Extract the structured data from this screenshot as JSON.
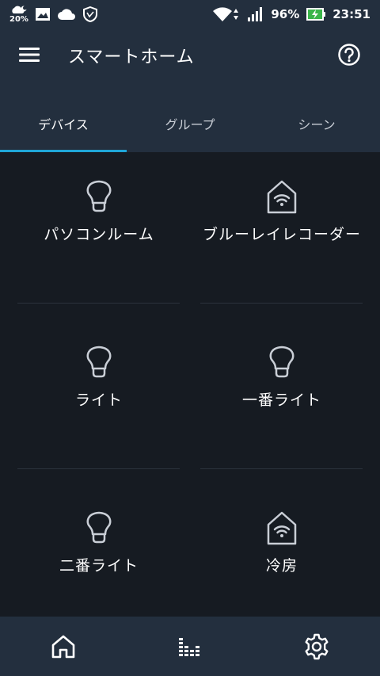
{
  "status_bar": {
    "weather_pct": "20%",
    "battery": "96%",
    "time": "23:51"
  },
  "app_bar": {
    "title": "スマートホーム"
  },
  "tabs": [
    {
      "label": "デバイス",
      "active": true
    },
    {
      "label": "グループ",
      "active": false
    },
    {
      "label": "シーン",
      "active": false
    }
  ],
  "devices": [
    {
      "label": "パソコンルーム",
      "icon": "lightbulb-icon"
    },
    {
      "label": "ブルーレイレコーダー",
      "icon": "smart-home-icon"
    },
    {
      "label": "ライト",
      "icon": "lightbulb-icon"
    },
    {
      "label": "一番ライト",
      "icon": "lightbulb-icon"
    },
    {
      "label": "二番ライト",
      "icon": "lightbulb-icon"
    },
    {
      "label": "冷房",
      "icon": "smart-home-icon"
    }
  ],
  "bottom_nav": [
    "home-icon",
    "equalizer-icon",
    "settings-icon"
  ],
  "colors": {
    "bar_bg": "#232f3e",
    "content_bg": "#161b22",
    "accent": "#1fa6d8",
    "icon_stroke": "#c9ced6"
  }
}
